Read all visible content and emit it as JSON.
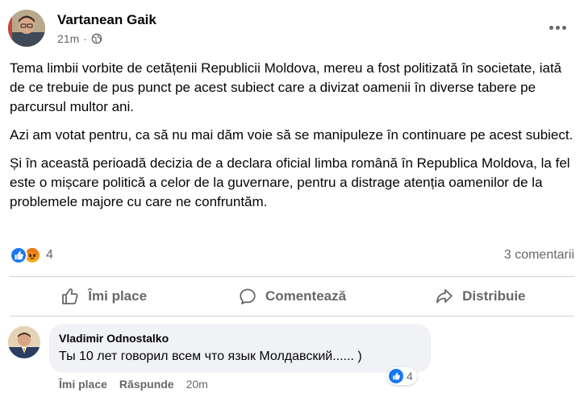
{
  "post": {
    "author": "Vartanean Gaik",
    "time": "21m",
    "separator": "·",
    "paragraphs": [
      "Tema limbii vorbite de cetățenii Republicii Moldova, mereu a fost politizată în societate, iată de ce trebuie de pus punct pe acest subiect care a divizat oamenii în diverse tabere pe parcursul multor ani.",
      "Azi am votat pentru, ca să nu mai dăm voie să se manipuleze în continuare pe acest subiect.",
      "Și în această perioadă decizia de a declara oficial limba română în Republica Moldova, la fel este o mișcare politică a celor de la guvernare, pentru a distrage atenția oamenilor de la problemele majore cu care ne confruntăm."
    ],
    "reaction_count": "4",
    "comments_count": "3 comentarii"
  },
  "actions": {
    "like": "Îmi place",
    "comment": "Comentează",
    "share": "Distribuie"
  },
  "comment": {
    "author": "Vladimir Odnostalko",
    "text": "Ты 10 лет говорил всем что язык Молдавский...... )",
    "reaction_count": "4",
    "like_label": "Îmi place",
    "reply_label": "Răspunde",
    "time": "20m"
  },
  "colors": {
    "like_blue": "#1877f2",
    "angry_orange": "#e9710f",
    "meta_gray": "#65676b",
    "bubble_bg": "#f0f2f5"
  }
}
